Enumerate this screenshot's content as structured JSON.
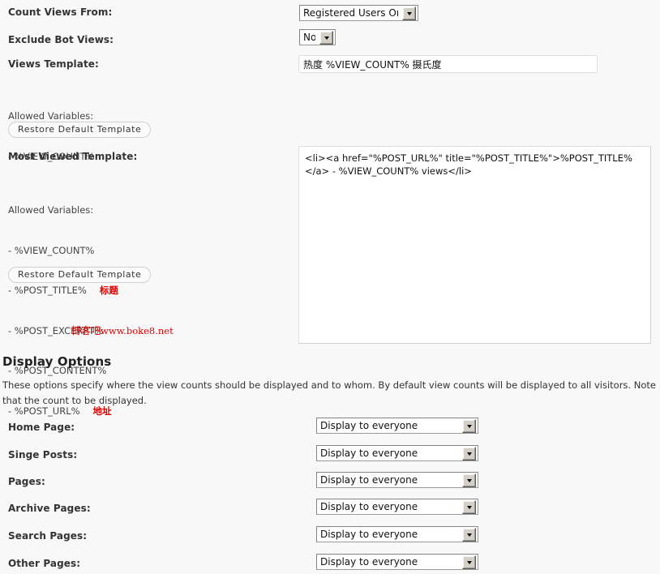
{
  "form": {
    "count_views_from": {
      "label": "Count Views From:",
      "value": "Registered Users Only"
    },
    "exclude_bot_views": {
      "label": "Exclude Bot Views:",
      "value": "No"
    },
    "views_template": {
      "label": "Views Template:",
      "value": "热度 %VIEW_COUNT% 摄氏度"
    },
    "views_allowed": {
      "heading": "Allowed Variables:",
      "items": [
        {
          "name": "- %VIEW_COUNT%",
          "note": ""
        }
      ]
    },
    "restore_views_button": "Restore Default Template",
    "most_viewed_template": {
      "label": "Most Viewed Template:",
      "value": "<li><a href=\"%POST_URL%\" title=\"%POST_TITLE%\">%POST_TITLE%</a> - %VIEW_COUNT% views</li>"
    },
    "most_viewed_allowed": {
      "heading": "Allowed Variables:",
      "items": [
        {
          "name": "- %VIEW_COUNT%",
          "note": ""
        },
        {
          "name": "- %POST_TITLE%",
          "note": "标题"
        },
        {
          "name": "- %POST_EXCERPT%",
          "note": ""
        },
        {
          "name": "- %POST_CONTENT%",
          "note": ""
        },
        {
          "name": "- %POST_URL%",
          "note": "地址"
        }
      ]
    },
    "restore_most_viewed_button": "Restore Default Template"
  },
  "watermark": {
    "cjk": "博客吧",
    "latin": "www.boke8.net"
  },
  "display_options": {
    "title": "Display Options",
    "description": "These options specify where the view counts should be displayed and to whom. By default view counts will be displayed to all visitors. Note that the count to be displayed.",
    "rows": [
      {
        "label": "Home Page:",
        "value": "Display to everyone"
      },
      {
        "label": "Singe Posts:",
        "value": "Display to everyone"
      },
      {
        "label": "Pages:",
        "value": "Display to everyone"
      },
      {
        "label": "Archive Pages:",
        "value": "Display to everyone"
      },
      {
        "label": "Search Pages:",
        "value": "Display to everyone"
      },
      {
        "label": "Other Pages:",
        "value": "Display to everyone"
      }
    ]
  },
  "colors": {
    "background": "#f8f8f8",
    "annotation_red": "#dd0000",
    "text": "#333333"
  }
}
